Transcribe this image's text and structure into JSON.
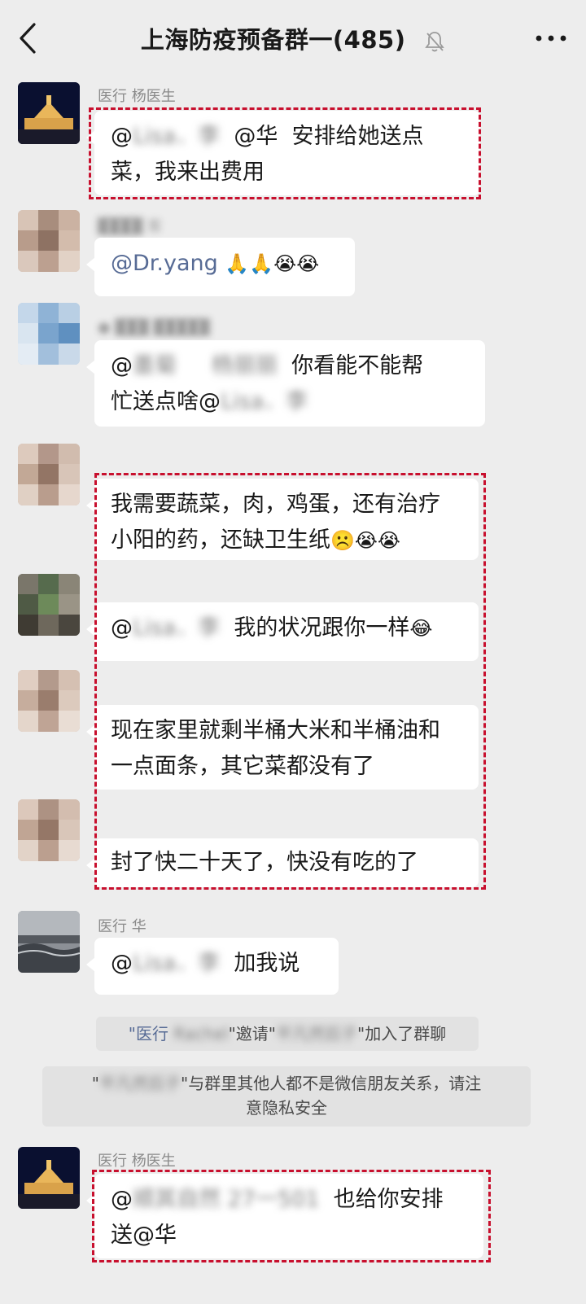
{
  "header": {
    "title": "上海防疫预备群一(485)",
    "back_icon": "chevron-left-icon",
    "mute_icon": "bell-muted-icon",
    "more_icon": "more-dots-icon"
  },
  "messages": [
    {
      "sender": "医行 杨医生",
      "line1_mention": "@华",
      "line1_text": "安排给她送点",
      "line2": "菜，我来出费用"
    },
    {
      "sender_blurred": true,
      "mention": "@Dr.yang",
      "emoji": "🙏🙏😭😭"
    },
    {
      "line1_text": "你看能不能帮",
      "line2_text": "忙送点啥"
    },
    {
      "line1": "我需要蔬菜，肉，鸡蛋，还有治疗",
      "line2": "小阳的药，还缺卫生纸",
      "emoji": "☹️😭😭"
    },
    {
      "text": "我的状况跟你一样",
      "emoji": "😂"
    },
    {
      "line1": "现在家里就剩半桶大米和半桶油和",
      "line2": "一点面条，其它菜都没有了"
    },
    {
      "text": "封了快二十天了，快没有吃的了"
    },
    {
      "sender": "医行 华",
      "text": "加我说"
    },
    {
      "sender": "医行 杨医生",
      "line1_text": "也给你安排",
      "line2": "送@华"
    }
  ],
  "system": [
    {
      "prefix": "\"医行",
      "mid": "\"邀请\"",
      "suffix": "\"加入了群聊"
    },
    {
      "line1": "\"与群里其他人都不是微信朋友关系，请注",
      "line2": "意隐私安全"
    }
  ],
  "colors": {
    "background": "#ededed",
    "bubble": "#ffffff",
    "mention": "#576b95",
    "highlight_box": "#c8102e"
  }
}
